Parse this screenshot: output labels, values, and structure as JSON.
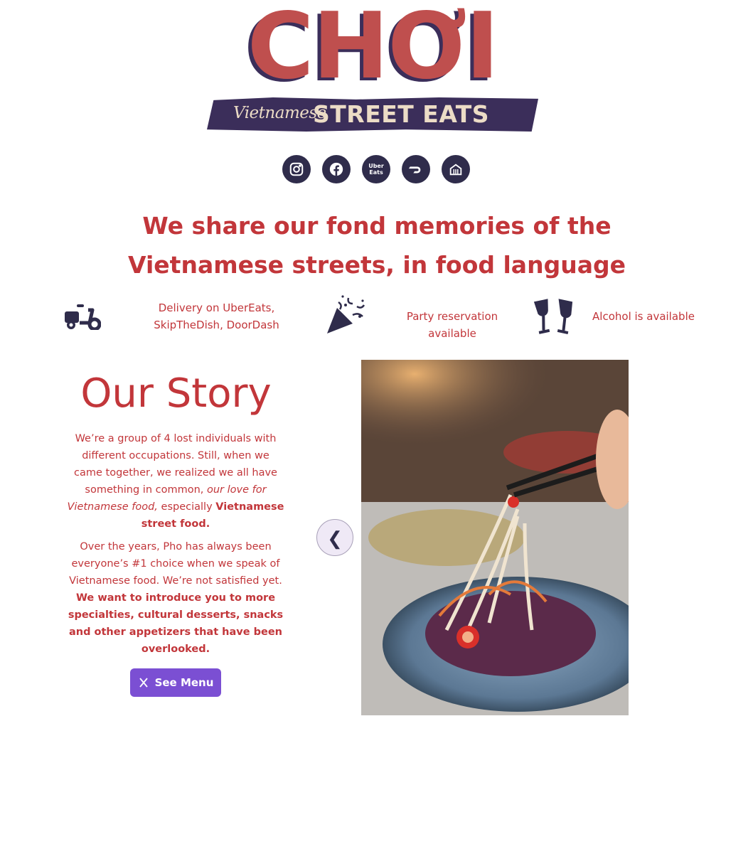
{
  "logo": {
    "title": "CHƠI",
    "subtitle_script": "Vietnamese",
    "subtitle_main": "STREET EATS"
  },
  "social": [
    {
      "name": "instagram-icon"
    },
    {
      "name": "facebook-icon"
    },
    {
      "name": "ubereats-icon",
      "label": "Uber Eats"
    },
    {
      "name": "doordash-icon"
    },
    {
      "name": "skipthedishes-icon"
    }
  ],
  "tagline": "We share our fond memories of the Vietnamese streets, in food language",
  "features": {
    "delivery": "Delivery on UberEats, SkipTheDish, DoorDash",
    "party": "Party reservation available",
    "alcohol": "Alcohol is available"
  },
  "story": {
    "title": "Our Story",
    "p1_a": "We’re a group of 4 lost individuals with different occupations. Still, when we came together, we realized we all have something in common, ",
    "p1_b": "our love for Vietnamese food,",
    "p1_c": " especially ",
    "p1_d": "Vietnamese street food.",
    "p2_a": "Over the years, Pho has always been everyone’s #1 choice when we speak of Vietnamese food. We’re not satisfied yet. ",
    "p2_b": "We want to introduce you to more specialties, cultural desserts, snacks and other appetizers that have been overlooked.",
    "menu_button": "See Menu"
  },
  "carousel": {
    "prev_label": "❮"
  },
  "colors": {
    "brand_red": "#c2363a",
    "navy": "#2f2c4b",
    "button": "#7b4fd3"
  }
}
